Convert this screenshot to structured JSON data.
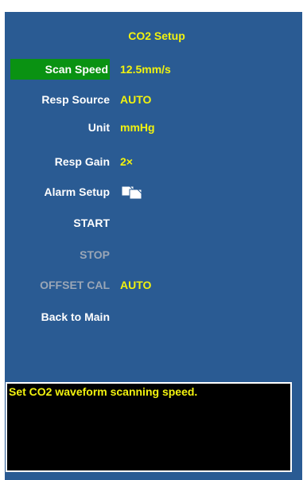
{
  "window": {
    "title": "CO2 Setup"
  },
  "rows": [
    {
      "label": "Scan Speed",
      "value": "12.5mm/s",
      "selected": true
    },
    {
      "label": "Resp Source",
      "value": "AUTO"
    },
    {
      "label": "Unit",
      "value": "mmHg"
    },
    {
      "label": "Resp Gain",
      "value": "2×"
    },
    {
      "label": "Alarm Setup",
      "icon": "documents-icon"
    },
    {
      "label": "START"
    },
    {
      "label": "STOP",
      "disabled": true
    },
    {
      "label": "OFFSET CAL",
      "value": "AUTO",
      "disabled": true
    },
    {
      "label": "Back to Main"
    }
  ],
  "help": {
    "message": "Set CO2 waveform scanning speed."
  },
  "colors": {
    "panel": "#2a5b93",
    "accent": "#f2f20f",
    "selected": "#0a9212",
    "disabled": "#9aa6b6",
    "help_bg": "#000000"
  }
}
